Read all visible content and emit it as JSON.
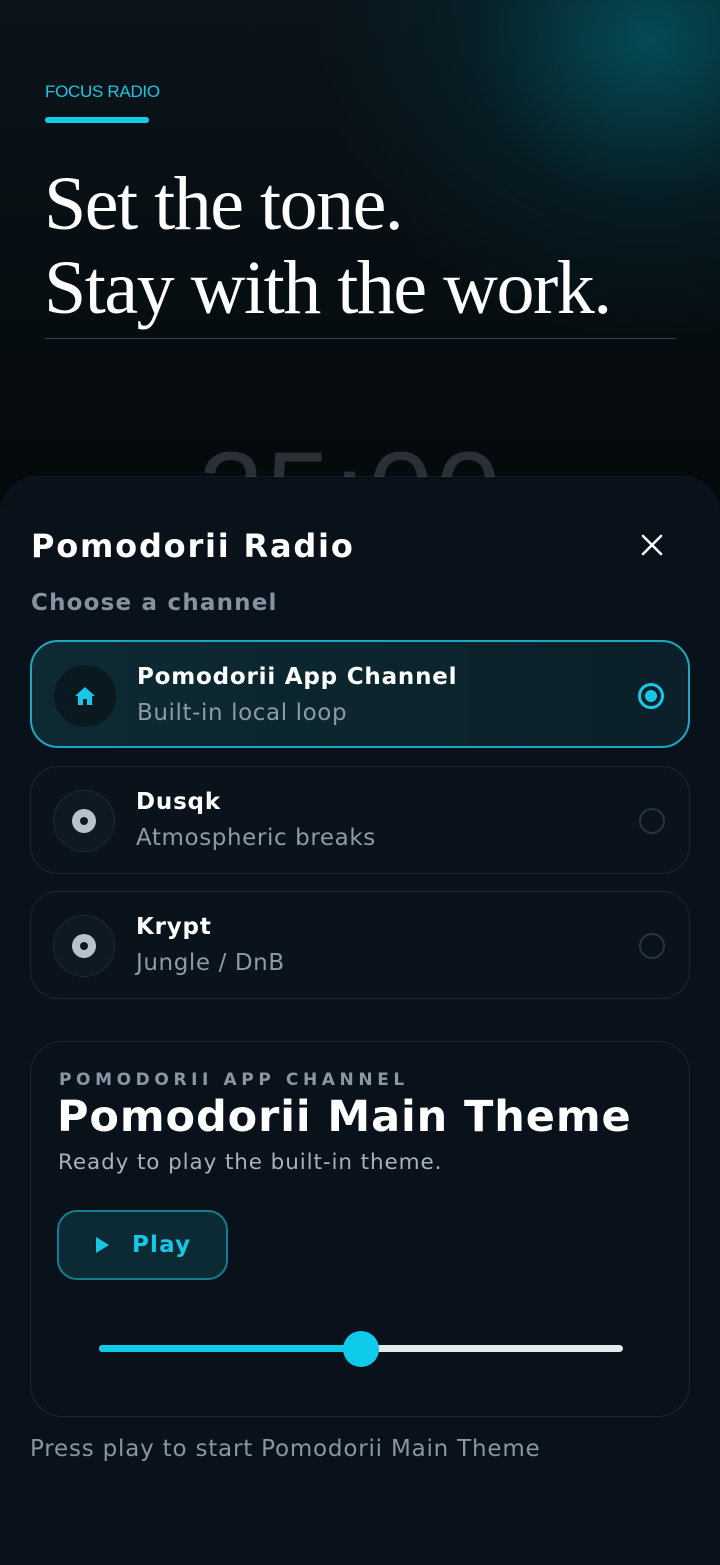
{
  "hero": {
    "eyebrow": "FOCUS RADIO",
    "headline_line1": "Set the tone.",
    "headline_line2": "Stay with the work.",
    "timer": "25:00"
  },
  "sheet": {
    "title": "Pomodorii Radio",
    "subtitle": "Choose a channel",
    "channels": [
      {
        "name": "Pomodorii App Channel",
        "description": "Built-in local loop",
        "icon": "home-icon",
        "selected": true
      },
      {
        "name": "Dusqk",
        "description": "Atmospheric breaks",
        "icon": "disc-icon",
        "selected": false
      },
      {
        "name": "Krypt",
        "description": "Jungle / DnB",
        "icon": "disc-icon",
        "selected": false
      }
    ]
  },
  "player": {
    "channel_label": "POMODORII APP CHANNEL",
    "track_title": "Pomodorii Main Theme",
    "status": "Ready to play the built-in theme.",
    "play_label": "Play",
    "volume": 0.5
  },
  "footer": {
    "hint": "Press play to start Pomodorii Main Theme"
  },
  "colors": {
    "accent": "#14c8e6",
    "sheet_bg": "#09111a",
    "page_bg": "#030608"
  }
}
